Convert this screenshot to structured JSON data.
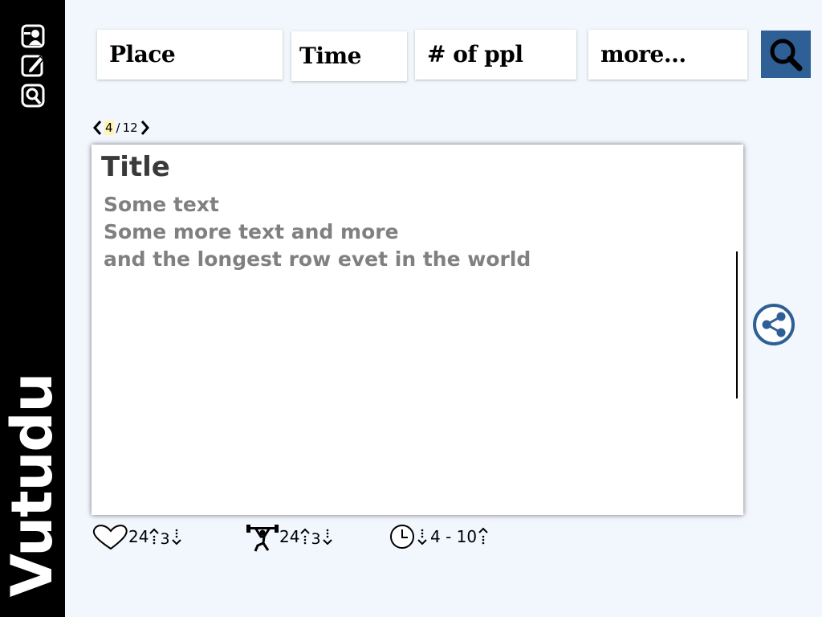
{
  "sidebar": {
    "brand": "Vutudu",
    "icons": [
      "profile-icon",
      "edit-icon",
      "search-icon"
    ]
  },
  "filters": {
    "place": "Place",
    "time": "Time",
    "people": "# of ppl",
    "more": "more..."
  },
  "pager": {
    "current": "4",
    "separator": "/",
    "total": "12"
  },
  "card": {
    "title": "Title",
    "lines": [
      "Some text",
      "Some more text and more",
      "and the longest row evet in the world"
    ]
  },
  "stats": {
    "likes": {
      "up": "24",
      "down": "3"
    },
    "effort": {
      "up": "24",
      "down": "3"
    },
    "duration": {
      "range": "4 - 10"
    }
  },
  "colors": {
    "accent": "#2e5f95",
    "sidebar": "#000000",
    "background": "#f2f6fd"
  }
}
